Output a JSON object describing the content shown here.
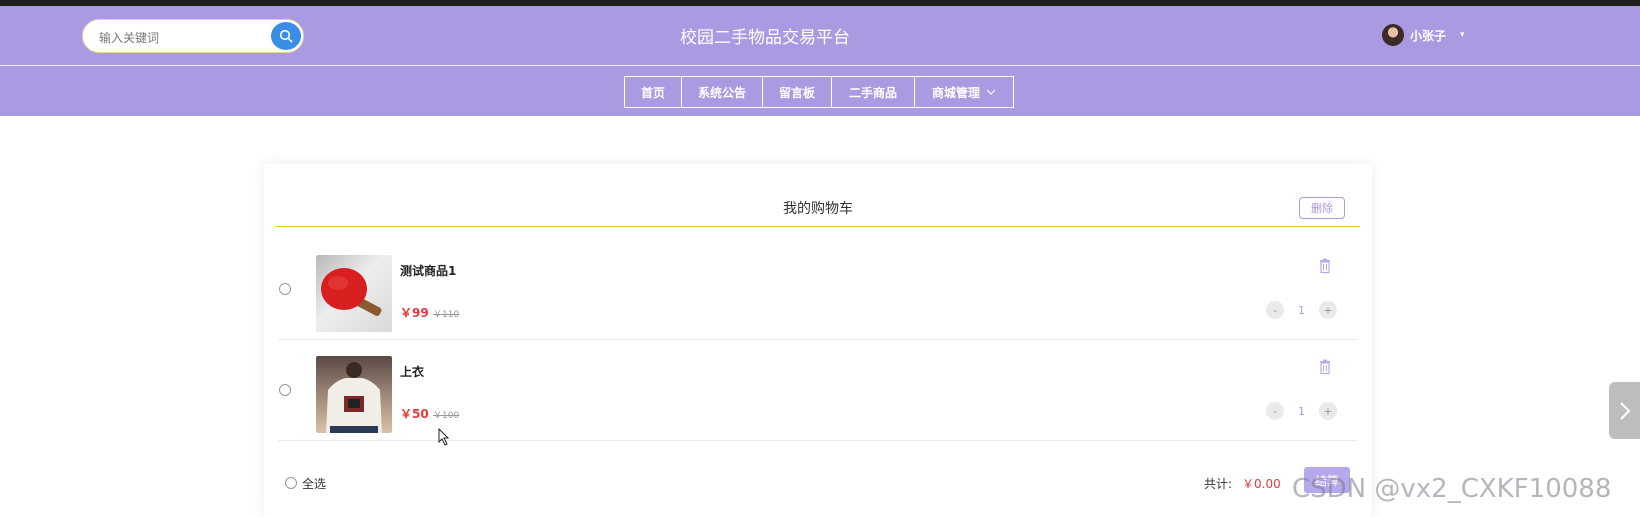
{
  "header": {
    "title": "校园二手物品交易平台",
    "search": {
      "placeholder": "输入关键词"
    },
    "user": {
      "name": "小张子",
      "caret": "▾"
    }
  },
  "nav": {
    "items": [
      {
        "label": "首页"
      },
      {
        "label": "系统公告"
      },
      {
        "label": "留言板"
      },
      {
        "label": "二手商品"
      },
      {
        "label": "商城管理",
        "has_dropdown": true
      }
    ]
  },
  "cart": {
    "title": "我的购物车",
    "delete_label": "删除",
    "items": [
      {
        "name": "测试商品1",
        "price": "￥99",
        "original_price": "￥110",
        "quantity": "1",
        "minus": "-",
        "plus": "+",
        "image": "red-ping-pong-paddle"
      },
      {
        "name": "上衣",
        "price": "￥50",
        "original_price": "￥100",
        "quantity": "1",
        "minus": "-",
        "plus": "+",
        "image": "white-sweatshirt"
      }
    ],
    "footer": {
      "select_all_label": "全选",
      "total_label": "共计:",
      "total_value": "￥0.00",
      "checkout_label": "结算"
    }
  },
  "watermark": "CSDN @vx2_CXKF10088",
  "colors": {
    "header_bg": "#a99ae2",
    "accent": "#a99ae2",
    "price": "#e4393c",
    "search_button": "#3a8ee6",
    "title_rule": "#f0c040"
  }
}
